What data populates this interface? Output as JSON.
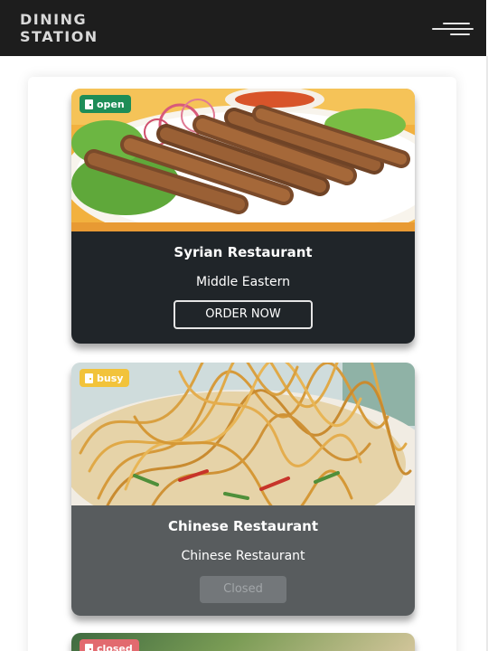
{
  "app": {
    "brand": "DINING\nSTATION"
  },
  "restaurants": [
    {
      "status": "open",
      "name": "Syrian Restaurant",
      "cuisine": "Middle Eastern",
      "action_label": "ORDER NOW",
      "status_color": "#1e8d57",
      "photo_subject": "seekh kebabs"
    },
    {
      "status": "busy",
      "name": "Chinese Restaurant",
      "cuisine": "Chinese Restaurant",
      "action_label": "Closed",
      "status_color": "#f2c33b",
      "photo_subject": "noodles"
    },
    {
      "status": "closed",
      "status_color": "#e26a6f",
      "photo_subject": "food"
    }
  ],
  "icons": {
    "menu": "hamburger-menu-icon",
    "status": "door-icon"
  }
}
